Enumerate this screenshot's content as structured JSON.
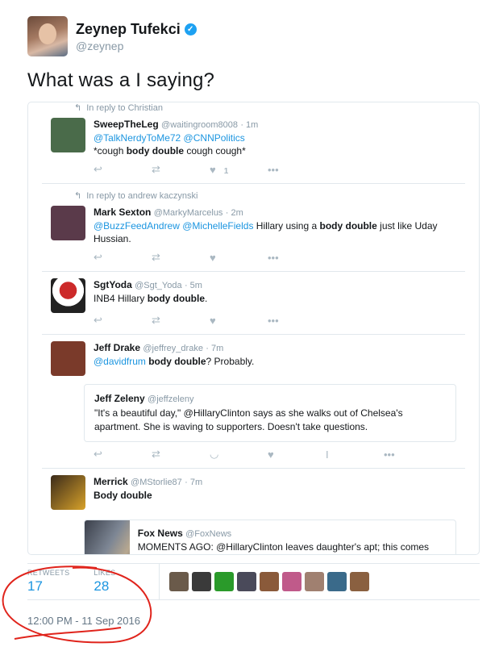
{
  "author": {
    "name": "Zeynep Tufekci",
    "handle": "@zeynep",
    "verified_icon": "verified-badge-icon"
  },
  "tweet": {
    "text": "What was a I saying?"
  },
  "embed": {
    "replies": [
      {
        "in_reply_to": "In reply to Christian",
        "name": "SweepTheLeg",
        "handle": "@waitingroom8008",
        "time": "· 1m",
        "mentions": "@TalkNerdyToMe72 @CNNPolitics",
        "text_pre": "*cough ",
        "text_bold": "body double",
        "text_post": " cough cough*",
        "like_count": "1",
        "avatar_color": "#4a6b4a"
      },
      {
        "in_reply_to": "In reply to andrew kaczynski",
        "name": "Mark Sexton",
        "handle": "@MarkyMarcelus",
        "time": "· 2m",
        "mentions": "@BuzzFeedAndrew @MichelleFields",
        "text_pre": " Hillary using a ",
        "text_bold": "body double",
        "text_post": " just like Uday Hussian.",
        "avatar_color": "#5a3a4a"
      },
      {
        "name": "SgtYoda",
        "handle": "@Sgt_Yoda",
        "time": "· 5m",
        "text_pre": "INB4 Hillary ",
        "text_bold": "body double",
        "text_post": ".",
        "avatar_color": "#cc2a2a"
      },
      {
        "name": "Jeff Drake",
        "handle": "@jeffrey_drake",
        "time": "· 7m",
        "mentions": "@davidfrum",
        "text_pre": " ",
        "text_bold": "body double",
        "text_post": "?  Probably.",
        "avatar_color": "#7a3a2a",
        "quote": {
          "name": "Jeff Zeleny",
          "handle": "@jeffzeleny",
          "text": "\"It's a beautiful day,\" @HillaryClinton says as she walks out of Chelsea's apartment. She is waving to supporters. Doesn't take questions."
        }
      },
      {
        "name": "Merrick",
        "handle": "@MStorlie87",
        "time": "· 7m",
        "text_bold": "Body double",
        "avatar_color": "#3a2a1a",
        "card": {
          "name": "Fox News",
          "handle": "@FoxNews",
          "text": "MOMENTS AGO: @HillaryClinton leaves daughter's apt; this comes after leaving WTC after reported 'medical episode.'"
        }
      }
    ]
  },
  "stats": {
    "retweets_label": "RETWEETS",
    "retweets_value": "17",
    "likes_label": "LIKES",
    "likes_value": "28",
    "liker_colors": [
      "#6a5a4a",
      "#3a3a3a",
      "#2a9a2a",
      "#4a4a5a",
      "#8a5a3a",
      "#c05a8a",
      "#a08070",
      "#3a6a8a",
      "#8a6040"
    ]
  },
  "timestamp": "12:00 PM - 11 Sep 2016",
  "colors": {
    "link": "#1b95e0",
    "muted": "#8899a6",
    "annotation": "#e0241c"
  }
}
